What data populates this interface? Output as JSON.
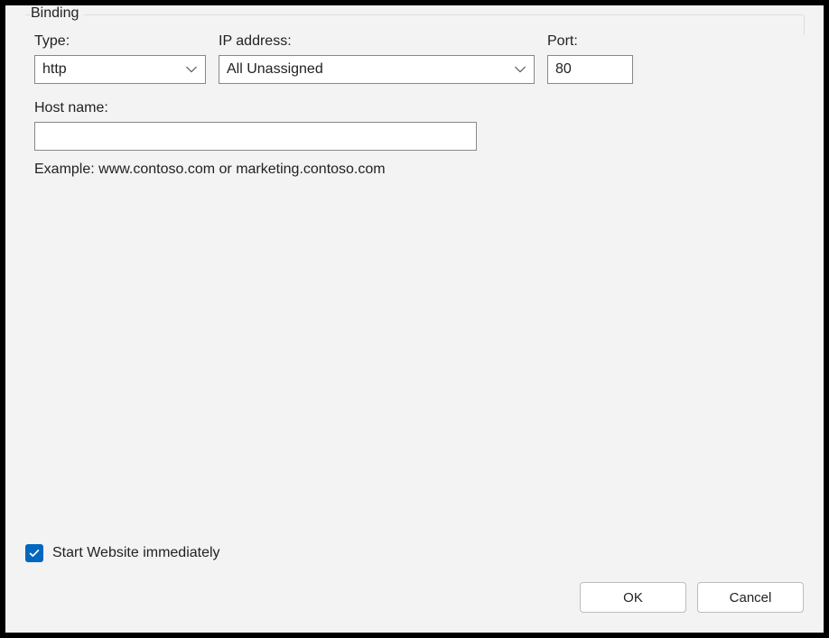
{
  "fieldset": {
    "legend": "Binding",
    "type": {
      "label": "Type:",
      "value": "http"
    },
    "ip": {
      "label": "IP address:",
      "value": "All Unassigned"
    },
    "port": {
      "label": "Port:",
      "value": "80"
    },
    "host": {
      "label": "Host name:",
      "value": ""
    },
    "example": "Example: www.contoso.com or marketing.contoso.com"
  },
  "checkbox": {
    "label": "Start Website immediately",
    "checked": true
  },
  "buttons": {
    "ok": "OK",
    "cancel": "Cancel"
  }
}
